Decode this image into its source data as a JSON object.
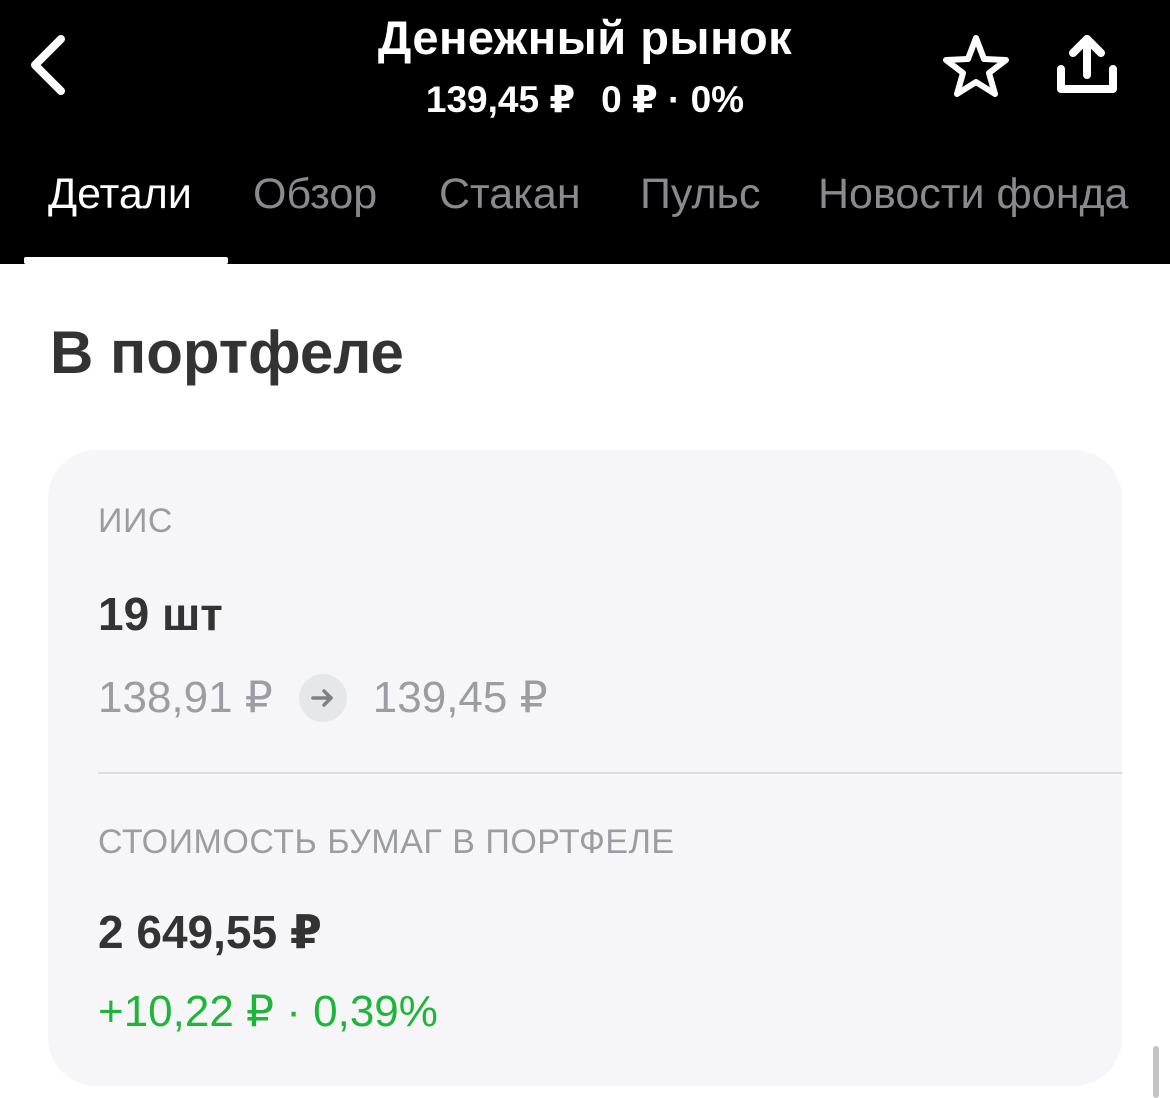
{
  "header": {
    "title": "Денежный рынок",
    "price": "139,45 ₽",
    "change": "0 ₽ · 0%"
  },
  "tabs": [
    {
      "label": "Детали",
      "active": true
    },
    {
      "label": "Обзор",
      "active": false
    },
    {
      "label": "Стакан",
      "active": false
    },
    {
      "label": "Пульс",
      "active": false
    },
    {
      "label": "Новости фонда",
      "active": false
    }
  ],
  "section": {
    "title": "В портфеле"
  },
  "portfolio": {
    "account_label": "ИИС",
    "quantity": "19 шт",
    "avg_price": "138,91 ₽",
    "current_price": "139,45 ₽",
    "value_label": "СТОИМОСТЬ БУМАГ В ПОРТФЕЛЕ",
    "value": "2 649,55 ₽",
    "value_change": "+10,22 ₽ · 0,39%"
  },
  "icons": {
    "back": "chevron-left-icon",
    "favorite": "star-outline-icon",
    "share": "share-upload-icon",
    "arrow": "arrow-right-icon"
  },
  "colors": {
    "header_bg": "#000000",
    "positive": "#1fb53a",
    "muted": "#9b9da3",
    "card_bg": "#f6f6f8"
  }
}
